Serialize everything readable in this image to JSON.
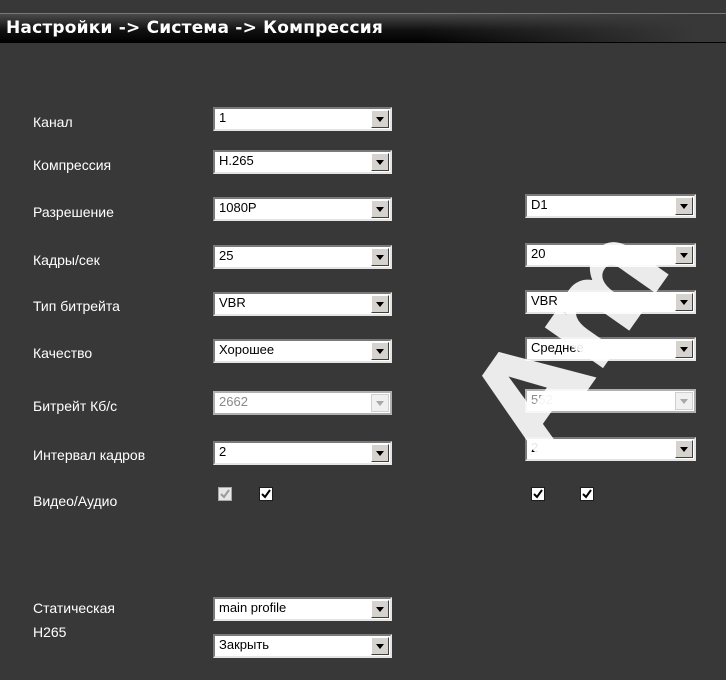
{
  "header": {
    "title": "Настройки -> Система -> Компрессия"
  },
  "labels": {
    "channel": "Канал",
    "compression": "Компрессия",
    "resolution": "Разрешение",
    "fps": "Кадры/сек",
    "bitrate_type": "Тип битрейта",
    "quality": "Качество",
    "bitrate": "Битрейт Кб/с",
    "frame_interval": "Интервал кадров",
    "video_audio": "Видео/Аудио",
    "static": "Статическая",
    "h265": "H265"
  },
  "main_stream": {
    "channel": "1",
    "compression": "H.265",
    "resolution": "1080P",
    "fps": "25",
    "bitrate_type": "VBR",
    "quality": "Хорошее",
    "bitrate": "2662",
    "frame_interval": "2",
    "video": true,
    "audio": true
  },
  "extra_stream": {
    "resolution": "D1",
    "fps": "20",
    "bitrate_type": "VBR",
    "quality": "Среднее",
    "bitrate": "552",
    "frame_interval": "2",
    "video": true,
    "audio": true
  },
  "advanced": {
    "static": "main profile",
    "h265": "Закрыть"
  },
  "watermark": {
    "text": "Am"
  },
  "colors": {
    "background": "#383838",
    "text": "#ffffff",
    "titlebar": "#000000"
  }
}
